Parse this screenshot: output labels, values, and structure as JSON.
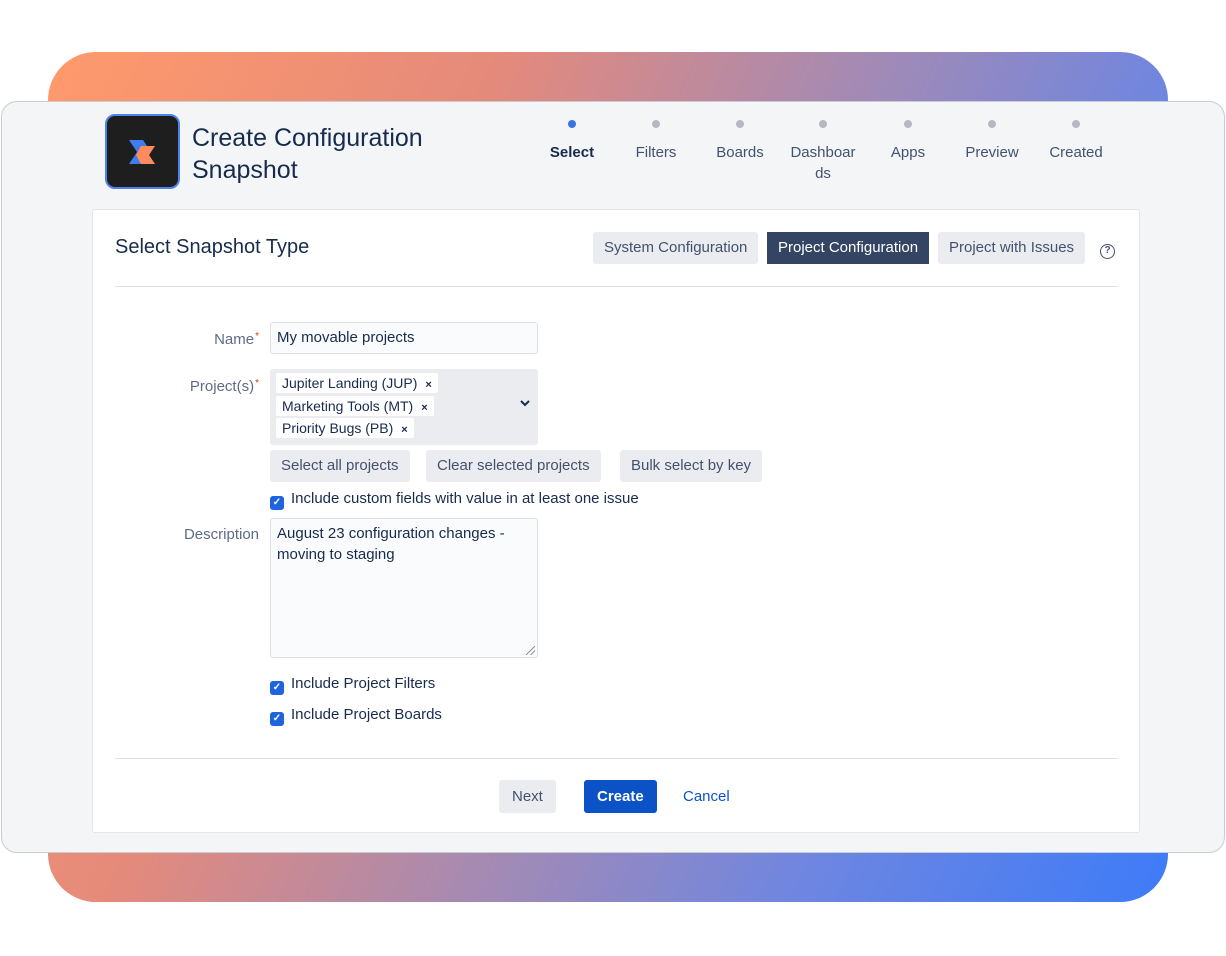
{
  "header": {
    "title": "Create Configuration Snapshot",
    "logo": "app-logo"
  },
  "steps": [
    {
      "label": "Select",
      "active": true
    },
    {
      "label": "Filters",
      "active": false
    },
    {
      "label": "Boards",
      "active": false
    },
    {
      "label": "Dashboards",
      "active": false
    },
    {
      "label": "Apps",
      "active": false
    },
    {
      "label": "Preview",
      "active": false
    },
    {
      "label": "Created",
      "active": false
    }
  ],
  "card": {
    "title": "Select Snapshot Type",
    "types": [
      "System Configuration",
      "Project Configuration",
      "Project with Issues"
    ],
    "selected_type": "Project Configuration",
    "help": "?"
  },
  "form": {
    "name_label": "Name",
    "name_value": "My movable projects",
    "projects_label": "Project(s)",
    "projects": [
      "Jupiter Landing (JUP)",
      "Marketing Tools (MT)",
      "Priority Bugs (PB)"
    ],
    "required_mark": "*",
    "remove_mark": "×",
    "select_all": "Select all projects",
    "clear_selected": "Clear selected projects",
    "bulk_select": "Bulk select by key",
    "include_custom_fields": "Include custom fields with value in at least one issue",
    "description_label": "Description",
    "description_value": "August 23 configuration changes - moving to staging",
    "include_filters": "Include Project Filters",
    "include_boards": "Include Project Boards"
  },
  "footer": {
    "next": "Next",
    "create": "Create",
    "cancel": "Cancel"
  },
  "colors": {
    "primary": "#0c52c7",
    "active_segment": "#344563",
    "step_active_dot": "#3b73e0"
  }
}
